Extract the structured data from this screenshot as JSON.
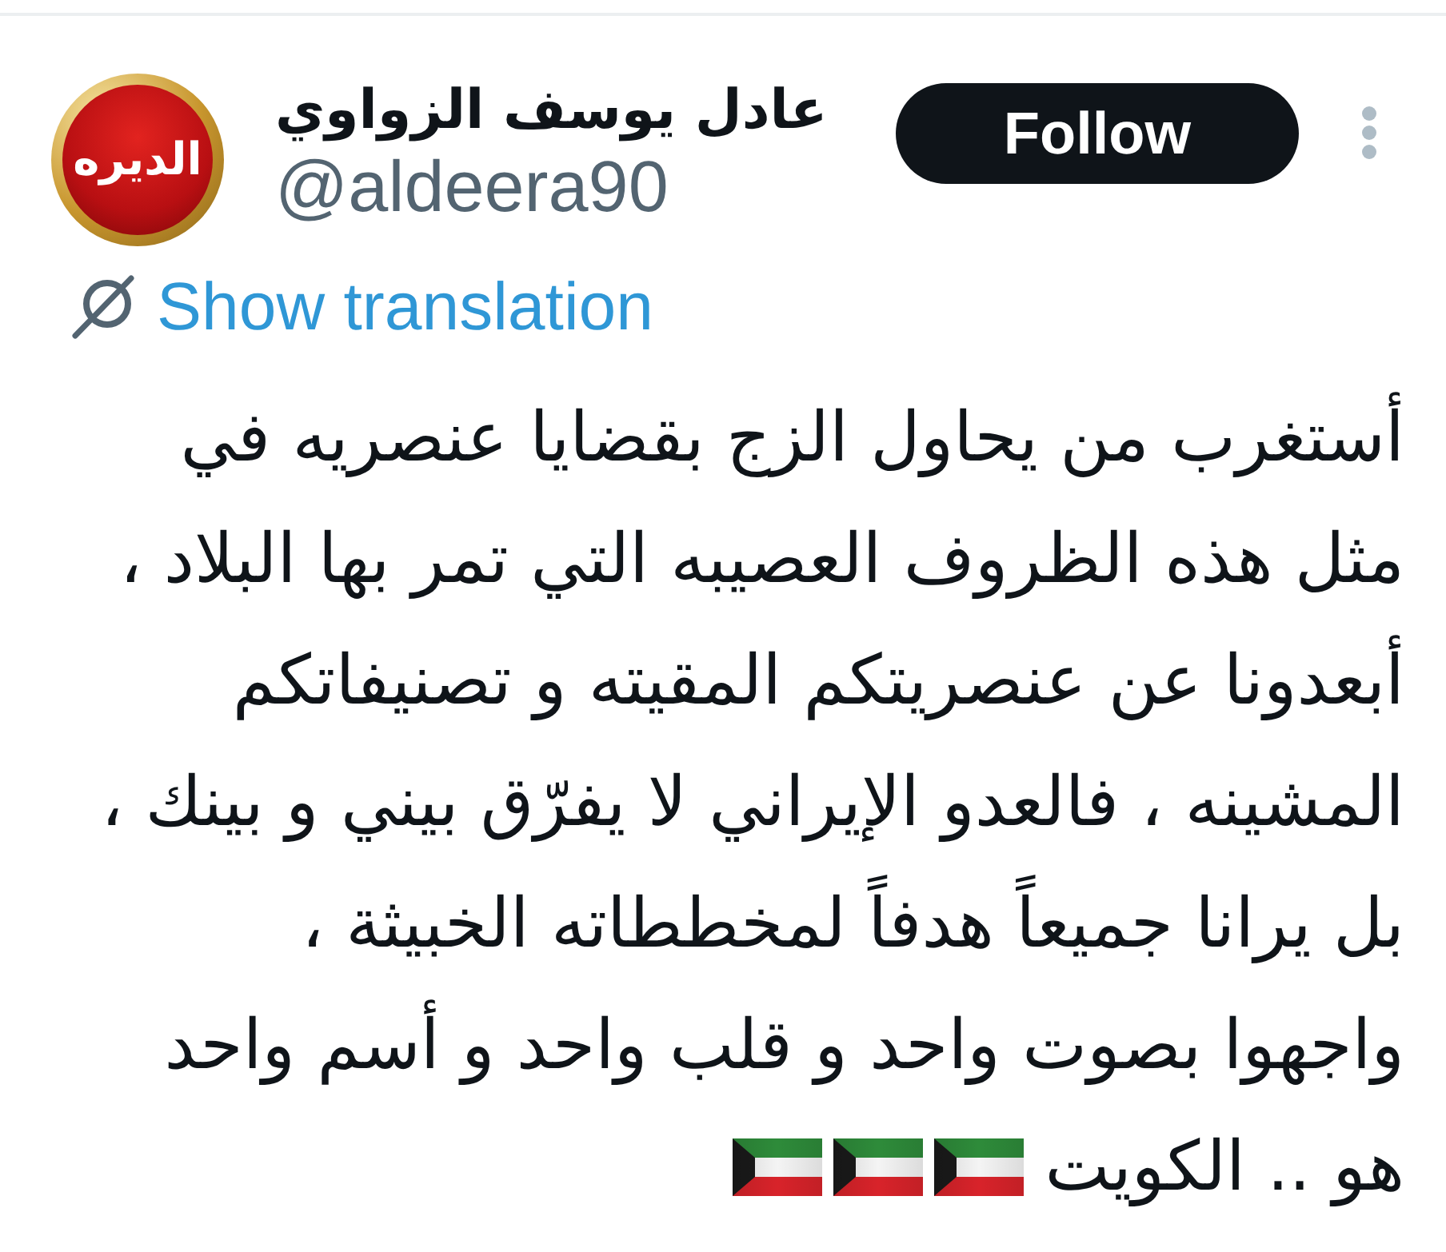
{
  "author": {
    "avatar": {
      "logo_text": "الديره"
    },
    "name": "عادل يوسف الزواوي",
    "handle": "@aldeera90"
  },
  "follow_button": {
    "label": "Follow"
  },
  "translation_link": {
    "label": "Show translation"
  },
  "tweet": {
    "lines": [
      "أستغرب من يحاول الزج بقضايا عنصريه في",
      "مثل هذه الظروف العصيبه التي تمر بها البلاد ،",
      "أبعدونا عن عنصريتكم المقيته و تصنيفاتكم",
      "المشينه ، فالعدو الإيراني لا يفرّق بيني و بينك ،",
      "بل يرانا جميعاً هدفاً لمخططاته الخبيثة ،",
      "واجهوا بصوت واحد و قلب واحد و أسم واحد",
      "هو .. الكويت"
    ],
    "emojis": [
      {
        "kind": "kuwait-flag"
      },
      {
        "kind": "kuwait-flag"
      },
      {
        "kind": "kuwait-flag"
      }
    ]
  }
}
